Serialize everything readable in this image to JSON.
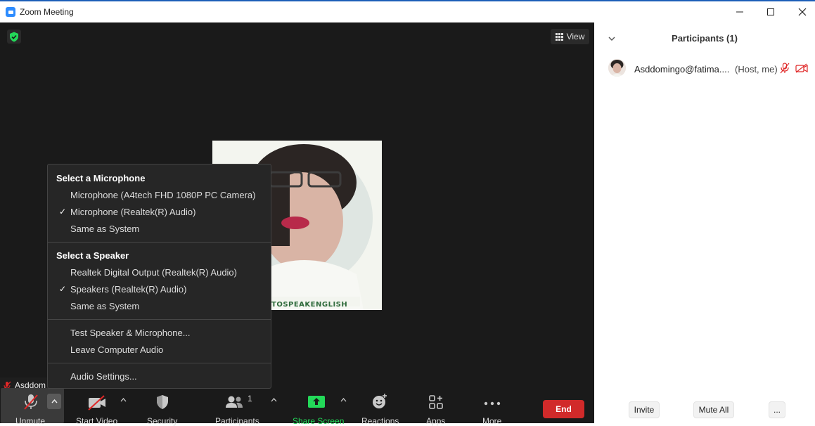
{
  "window": {
    "title": "Zoom Meeting",
    "controls": [
      "minimize",
      "maximize",
      "close"
    ]
  },
  "meeting": {
    "view_label": "View",
    "participant_nameplate": "Asddom",
    "avatar_watermark": "TOSPEAKENGLISH"
  },
  "audio_menu": {
    "microphone_header": "Select a Microphone",
    "microphones": [
      {
        "label": "Microphone (A4tech FHD 1080P PC Camera)",
        "checked": false
      },
      {
        "label": "Microphone (Realtek(R) Audio)",
        "checked": true
      },
      {
        "label": "Same as System",
        "checked": false
      }
    ],
    "speaker_header": "Select a Speaker",
    "speakers": [
      {
        "label": "Realtek Digital Output (Realtek(R) Audio)",
        "checked": false
      },
      {
        "label": "Speakers (Realtek(R) Audio)",
        "checked": true
      },
      {
        "label": "Same as System",
        "checked": false
      }
    ],
    "test_label": "Test Speaker & Microphone...",
    "leave_label": "Leave Computer Audio",
    "settings_label": "Audio Settings...",
    "check_glyph": "✓"
  },
  "toolbar": {
    "unmute": "Unmute",
    "start_video": "Start Video",
    "security": "Security",
    "participants": "Participants",
    "participants_count": "1",
    "share_screen": "Share Screen",
    "reactions": "Reactions",
    "apps": "Apps",
    "more": "More",
    "end": "End",
    "caret": "^"
  },
  "participants_panel": {
    "title": "Participants (1)",
    "participants": [
      {
        "name": "Asddomingo@fatima....",
        "role": "(Host, me)",
        "muted": true,
        "video_off": true
      }
    ],
    "invite": "Invite",
    "mute_all": "Mute All",
    "more": "..."
  },
  "colors": {
    "meeting_bg": "#1a1a1a",
    "menu_bg": "#262626",
    "end_red": "#d12a2a",
    "share_green": "#23d959",
    "muted_red": "#e02828",
    "zoom_blue": "#2d8cff"
  }
}
